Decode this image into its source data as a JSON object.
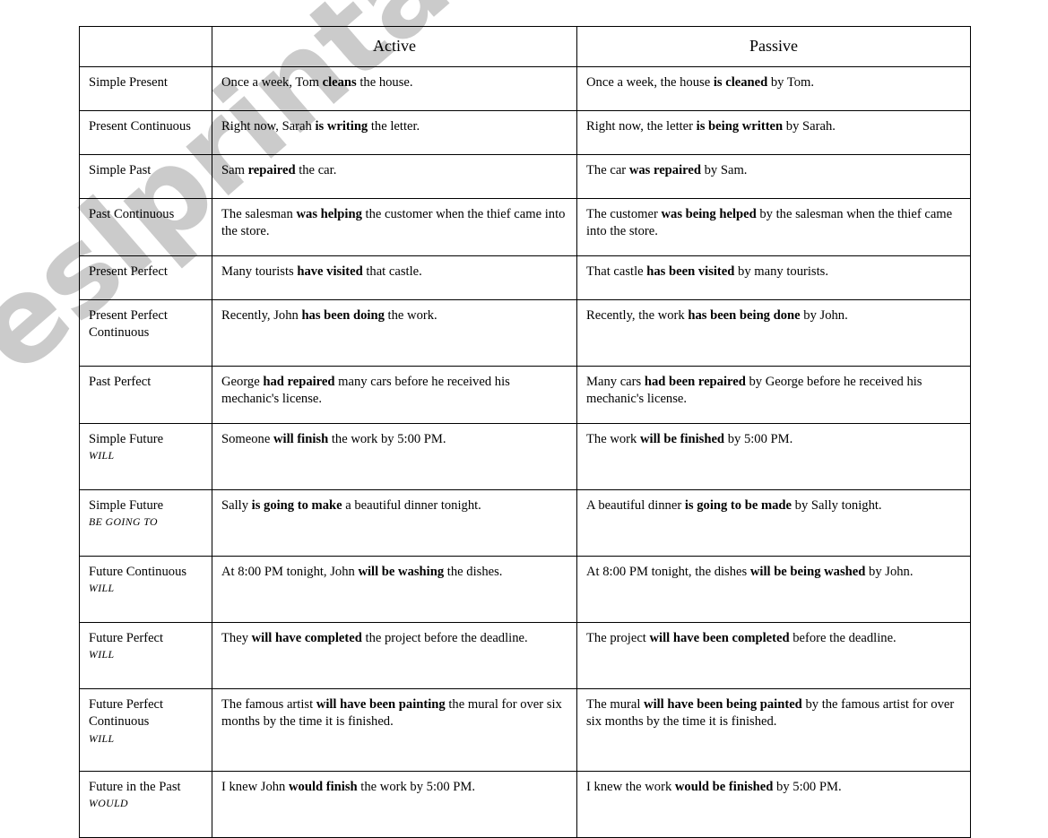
{
  "watermark": {
    "text": "eslprintables.com",
    "color": "#c9c9c9"
  },
  "table": {
    "headers": {
      "corner": "",
      "active": "Active",
      "passive": "Passive"
    },
    "rows": [
      {
        "tense": "Simple Present",
        "modal": "",
        "active_plain_1": "Once a week, Tom ",
        "active_bold": "cleans",
        "active_plain_2": " the house.",
        "passive_plain_1": "Once a week, the house ",
        "passive_bold": "is cleaned",
        "passive_plain_2": " by Tom."
      },
      {
        "tense": "Present Continuous",
        "modal": "",
        "active_plain_1": "Right now, Sarah ",
        "active_bold": "is writing",
        "active_plain_2": " the letter.",
        "passive_plain_1": "Right now, the letter ",
        "passive_bold": "is being written",
        "passive_plain_2": " by Sarah."
      },
      {
        "tense": "Simple Past",
        "modal": "",
        "active_plain_1": "Sam ",
        "active_bold": "repaired",
        "active_plain_2": " the car.",
        "passive_plain_1": "The car ",
        "passive_bold": "was repaired",
        "passive_plain_2": " by Sam."
      },
      {
        "tense": "Past Continuous",
        "modal": "",
        "active_plain_1": "The salesman ",
        "active_bold": "was helping",
        "active_plain_2": " the customer when the thief came into the store.",
        "passive_plain_1": "The customer ",
        "passive_bold": "was being helped",
        "passive_plain_2": " by the salesman when the thief came into the store."
      },
      {
        "tense": "Present Perfect",
        "modal": "",
        "active_plain_1": "Many tourists ",
        "active_bold": "have visited",
        "active_plain_2": " that castle.",
        "passive_plain_1": "That castle ",
        "passive_bold": "has been visited",
        "passive_plain_2": " by many tourists."
      },
      {
        "tense": "Present Perfect Continuous",
        "modal": "",
        "active_plain_1": "Recently, John ",
        "active_bold": "has been doing",
        "active_plain_2": " the work.",
        "passive_plain_1": "Recently, the work ",
        "passive_bold": "has been being done",
        "passive_plain_2": " by John."
      },
      {
        "tense": "Past Perfect",
        "modal": "",
        "active_plain_1": "George ",
        "active_bold": "had repaired",
        "active_plain_2": " many cars before he received his mechanic's license.",
        "passive_plain_1": "Many cars ",
        "passive_bold": "had been repaired",
        "passive_plain_2": " by George before he received his mechanic's license."
      },
      {
        "tense": "Simple Future",
        "modal": "WILL",
        "active_plain_1": "Someone ",
        "active_bold": "will finish",
        "active_plain_2": " the work by 5:00 PM.",
        "passive_plain_1": "The work ",
        "passive_bold": "will be finished",
        "passive_plain_2": " by 5:00 PM."
      },
      {
        "tense": "Simple Future",
        "modal": "BE GOING TO",
        "active_plain_1": "Sally ",
        "active_bold": "is going to make",
        "active_plain_2": " a beautiful dinner tonight.",
        "passive_plain_1": "A beautiful dinner ",
        "passive_bold": "is going to be made",
        "passive_plain_2": " by Sally tonight."
      },
      {
        "tense": "Future Continuous",
        "modal": "WILL",
        "active_plain_1": "At 8:00 PM tonight, John ",
        "active_bold": "will be washing",
        "active_plain_2": " the dishes.",
        "passive_plain_1": "At 8:00 PM tonight, the dishes ",
        "passive_bold": "will be being washed",
        "passive_plain_2": " by John."
      },
      {
        "tense": "Future Perfect",
        "modal": "WILL",
        "active_plain_1": "They ",
        "active_bold": "will have completed",
        "active_plain_2": " the project before the deadline.",
        "passive_plain_1": "The project ",
        "passive_bold": "will have been completed",
        "passive_plain_2": " before the deadline."
      },
      {
        "tense": "Future Perfect Continuous",
        "modal": "WILL",
        "active_plain_1": "The famous artist ",
        "active_bold": "will have been painting",
        "active_plain_2": " the mural for over six months by the time it is finished.",
        "passive_plain_1": "The mural ",
        "passive_bold": "will have been being painted",
        "passive_plain_2": " by the famous artist for over six months by the time it is finished."
      },
      {
        "tense": "Future in the Past",
        "modal": "WOULD",
        "active_plain_1": "I knew John ",
        "active_bold": "would finish",
        "active_plain_2": " the work by 5:00 PM.",
        "passive_plain_1": "I knew the work ",
        "passive_bold": "would be finished",
        "passive_plain_2": " by 5:00 PM."
      }
    ]
  }
}
